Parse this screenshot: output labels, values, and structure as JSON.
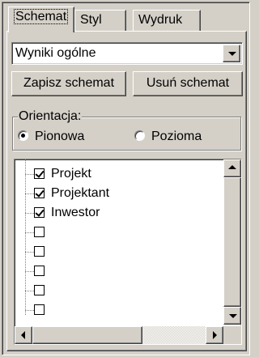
{
  "tabs": [
    {
      "label": "Schemat",
      "active": true
    },
    {
      "label": "Styl",
      "active": false
    },
    {
      "label": "Wydruk",
      "active": false
    }
  ],
  "schema_select": {
    "value": "Wyniki ogólne"
  },
  "buttons": {
    "save": "Zapisz schemat",
    "delete": "Usuń schemat"
  },
  "orientation": {
    "legend": "Orientacja:",
    "options": [
      {
        "label": "Pionowa",
        "selected": true
      },
      {
        "label": "Pozioma",
        "selected": false
      }
    ]
  },
  "tree": {
    "items": [
      {
        "label": "Projekt",
        "checked": true
      },
      {
        "label": "Projektant",
        "checked": true
      },
      {
        "label": "Inwestor",
        "checked": true
      },
      {
        "label": "",
        "checked": false
      },
      {
        "label": "",
        "checked": false
      },
      {
        "label": "",
        "checked": false
      },
      {
        "label": "",
        "checked": false
      },
      {
        "label": "",
        "checked": false
      }
    ]
  },
  "icons": {
    "dropdown": "chevron-down-icon",
    "scroll_up": "arrow-up-icon",
    "scroll_down": "arrow-down-icon",
    "scroll_left": "arrow-left-icon",
    "scroll_right": "arrow-right-icon"
  },
  "colors": {
    "face": "#d4d0c8",
    "window": "#ffffff"
  }
}
